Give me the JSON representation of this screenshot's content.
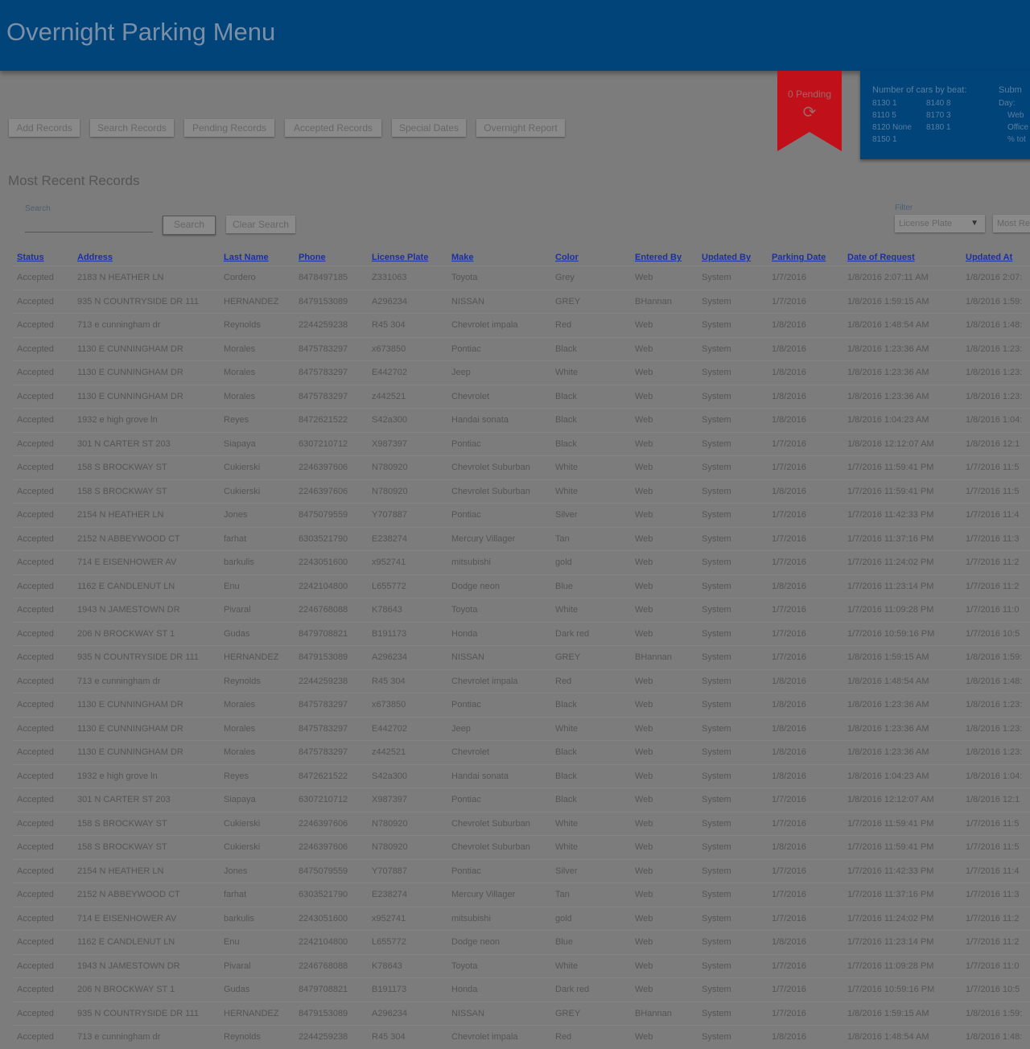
{
  "app": {
    "title": "Overnight Parking Menu"
  },
  "nav": {
    "buttons": [
      "Add Records",
      "Search Records",
      "Pending Records",
      "Accepted Records",
      "Special Dates",
      "Overnight Report"
    ]
  },
  "pending": {
    "label": "0 Pending"
  },
  "stats": {
    "title": "Number of cars by beat:",
    "beats": [
      "8130 1",
      "8140 8",
      "8110 5",
      "8170 3",
      "8120 None",
      "8180 1",
      "8150 1"
    ],
    "submitted": {
      "title": "Subm",
      "day": "Day:",
      "web": "Web",
      "office": "Office",
      "total": "% tot"
    }
  },
  "section": {
    "title": "Most Recent Records"
  },
  "search": {
    "label": "Search",
    "value": "",
    "search_button": "Search",
    "clear_button": "Clear Search"
  },
  "filter": {
    "label": "Filter",
    "selected": "License Plate",
    "sort_selected": "Most Re"
  },
  "table": {
    "columns": [
      "Status",
      "Address",
      "Last Name",
      "Phone",
      "License Plate",
      "Make",
      "Color",
      "Entered By",
      "Updated By",
      "Parking Date",
      "Date of Request",
      "Updated At"
    ],
    "rows": [
      [
        "Accepted",
        "2183 N HEATHER LN",
        "Cordero",
        "8478497185",
        "Z331063",
        "Toyota",
        "Grey",
        "Web",
        "System",
        "1/7/2016",
        "1/8/2016 2:07:11 AM",
        "1/8/2016 2:07:"
      ],
      [
        "Accepted",
        "935 N COUNTRYSIDE DR 111",
        "HERNANDEZ",
        "8479153089",
        "A296234",
        "NISSAN",
        "GREY",
        "BHannan",
        "System",
        "1/7/2016",
        "1/8/2016 1:59:15 AM",
        "1/8/2016 1:59:"
      ],
      [
        "Accepted",
        "713 e cunningham dr",
        "Reynolds",
        "2244259238",
        "R45 304",
        "Chevrolet impala",
        "Red",
        "Web",
        "System",
        "1/8/2016",
        "1/8/2016 1:48:54 AM",
        "1/8/2016 1:48:"
      ],
      [
        "Accepted",
        "1130 E CUNNINGHAM DR",
        "Morales",
        "8475783297",
        "x673850",
        "Pontiac",
        "Black",
        "Web",
        "System",
        "1/8/2016",
        "1/8/2016 1:23:36 AM",
        "1/8/2016 1:23:"
      ],
      [
        "Accepted",
        "1130 E CUNNINGHAM DR",
        "Morales",
        "8475783297",
        "E442702",
        "Jeep",
        "White",
        "Web",
        "System",
        "1/8/2016",
        "1/8/2016 1:23:36 AM",
        "1/8/2016 1:23:"
      ],
      [
        "Accepted",
        "1130 E CUNNINGHAM DR",
        "Morales",
        "8475783297",
        "z442521",
        "Chevrolet",
        "Black",
        "Web",
        "System",
        "1/8/2016",
        "1/8/2016 1:23:36 AM",
        "1/8/2016 1:23:"
      ],
      [
        "Accepted",
        "1932 e high grove ln",
        "Reyes",
        "8472621522",
        "S42a300",
        "Handai sonata",
        "Black",
        "Web",
        "System",
        "1/8/2016",
        "1/8/2016 1:04:23 AM",
        "1/8/2016 1:04:"
      ],
      [
        "Accepted",
        "301 N CARTER ST 203",
        "Siapaya",
        "6307210712",
        "X987397",
        "Pontiac",
        "Black",
        "Web",
        "System",
        "1/7/2016",
        "1/8/2016 12:12:07 AM",
        "1/8/2016 12:1"
      ],
      [
        "Accepted",
        "158 S BROCKWAY ST",
        "Cukierski",
        "2246397606",
        "N780920",
        "Chevrolet Suburban",
        "White",
        "Web",
        "System",
        "1/7/2016",
        "1/7/2016 11:59:41 PM",
        "1/7/2016 11:5"
      ],
      [
        "Accepted",
        "158 S BROCKWAY ST",
        "Cukierski",
        "2246397606",
        "N780920",
        "Chevrolet Suburban",
        "White",
        "Web",
        "System",
        "1/8/2016",
        "1/7/2016 11:59:41 PM",
        "1/7/2016 11:5"
      ],
      [
        "Accepted",
        "2154 N HEATHER LN",
        "Jones",
        "8475079559",
        "Y707887",
        "Pontiac",
        "Silver",
        "Web",
        "System",
        "1/7/2016",
        "1/7/2016 11:42:33 PM",
        "1/7/2016 11:4"
      ],
      [
        "Accepted",
        "2152 N ABBEYWOOD CT",
        "farhat",
        "6303521790",
        "E238274",
        "Mercury Villager",
        "Tan",
        "Web",
        "System",
        "1/7/2016",
        "1/7/2016 11:37:16 PM",
        "1/7/2016 11:3"
      ],
      [
        "Accepted",
        "714 E EISENHOWER AV",
        "barkulis",
        "2243051600",
        "x952741",
        "mitsubishi",
        "gold",
        "Web",
        "System",
        "1/7/2016",
        "1/7/2016 11:24:02 PM",
        "1/7/2016 11:2"
      ],
      [
        "Accepted",
        "1162 E CANDLENUT LN",
        "Enu",
        "2242104800",
        "L655772",
        "Dodge neon",
        "Blue",
        "Web",
        "System",
        "1/8/2016",
        "1/7/2016 11:23:14 PM",
        "1/7/2016 11:2"
      ],
      [
        "Accepted",
        "1943 N JAMESTOWN DR",
        "Pivaral",
        "2246768088",
        "K78643",
        "Toyota",
        "White",
        "Web",
        "System",
        "1/7/2016",
        "1/7/2016 11:09:28 PM",
        "1/7/2016 11:0"
      ],
      [
        "Accepted",
        "206 N BROCKWAY ST 1",
        "Gudas",
        "8479708821",
        "B191173",
        "Honda",
        "Dark red",
        "Web",
        "System",
        "1/7/2016",
        "1/7/2016 10:59:16 PM",
        "1/7/2016 10:5"
      ],
      [
        "Accepted",
        "935 N COUNTRYSIDE DR 111",
        "HERNANDEZ",
        "8479153089",
        "A296234",
        "NISSAN",
        "GREY",
        "BHannan",
        "System",
        "1/7/2016",
        "1/8/2016 1:59:15 AM",
        "1/8/2016 1:59:"
      ],
      [
        "Accepted",
        "713 e cunningham dr",
        "Reynolds",
        "2244259238",
        "R45 304",
        "Chevrolet impala",
        "Red",
        "Web",
        "System",
        "1/8/2016",
        "1/8/2016 1:48:54 AM",
        "1/8/2016 1:48:"
      ],
      [
        "Accepted",
        "1130 E CUNNINGHAM DR",
        "Morales",
        "8475783297",
        "x673850",
        "Pontiac",
        "Black",
        "Web",
        "System",
        "1/8/2016",
        "1/8/2016 1:23:36 AM",
        "1/8/2016 1:23:"
      ],
      [
        "Accepted",
        "1130 E CUNNINGHAM DR",
        "Morales",
        "8475783297",
        "E442702",
        "Jeep",
        "White",
        "Web",
        "System",
        "1/8/2016",
        "1/8/2016 1:23:36 AM",
        "1/8/2016 1:23:"
      ],
      [
        "Accepted",
        "1130 E CUNNINGHAM DR",
        "Morales",
        "8475783297",
        "z442521",
        "Chevrolet",
        "Black",
        "Web",
        "System",
        "1/8/2016",
        "1/8/2016 1:23:36 AM",
        "1/8/2016 1:23:"
      ],
      [
        "Accepted",
        "1932 e high grove ln",
        "Reyes",
        "8472621522",
        "S42a300",
        "Handai sonata",
        "Black",
        "Web",
        "System",
        "1/8/2016",
        "1/8/2016 1:04:23 AM",
        "1/8/2016 1:04:"
      ],
      [
        "Accepted",
        "301 N CARTER ST 203",
        "Siapaya",
        "6307210712",
        "X987397",
        "Pontiac",
        "Black",
        "Web",
        "System",
        "1/7/2016",
        "1/8/2016 12:12:07 AM",
        "1/8/2016 12:1"
      ],
      [
        "Accepted",
        "158 S BROCKWAY ST",
        "Cukierski",
        "2246397606",
        "N780920",
        "Chevrolet Suburban",
        "White",
        "Web",
        "System",
        "1/7/2016",
        "1/7/2016 11:59:41 PM",
        "1/7/2016 11:5"
      ],
      [
        "Accepted",
        "158 S BROCKWAY ST",
        "Cukierski",
        "2246397606",
        "N780920",
        "Chevrolet Suburban",
        "White",
        "Web",
        "System",
        "1/8/2016",
        "1/7/2016 11:59:41 PM",
        "1/7/2016 11:5"
      ],
      [
        "Accepted",
        "2154 N HEATHER LN",
        "Jones",
        "8475079559",
        "Y707887",
        "Pontiac",
        "Silver",
        "Web",
        "System",
        "1/7/2016",
        "1/7/2016 11:42:33 PM",
        "1/7/2016 11:4"
      ],
      [
        "Accepted",
        "2152 N ABBEYWOOD CT",
        "farhat",
        "6303521790",
        "E238274",
        "Mercury Villager",
        "Tan",
        "Web",
        "System",
        "1/7/2016",
        "1/7/2016 11:37:16 PM",
        "1/7/2016 11:3"
      ],
      [
        "Accepted",
        "714 E EISENHOWER AV",
        "barkulis",
        "2243051600",
        "x952741",
        "mitsubishi",
        "gold",
        "Web",
        "System",
        "1/7/2016",
        "1/7/2016 11:24:02 PM",
        "1/7/2016 11:2"
      ],
      [
        "Accepted",
        "1162 E CANDLENUT LN",
        "Enu",
        "2242104800",
        "L655772",
        "Dodge neon",
        "Blue",
        "Web",
        "System",
        "1/8/2016",
        "1/7/2016 11:23:14 PM",
        "1/7/2016 11:2"
      ],
      [
        "Accepted",
        "1943 N JAMESTOWN DR",
        "Pivaral",
        "2246768088",
        "K78643",
        "Toyota",
        "White",
        "Web",
        "System",
        "1/7/2016",
        "1/7/2016 11:09:28 PM",
        "1/7/2016 11:0"
      ],
      [
        "Accepted",
        "206 N BROCKWAY ST 1",
        "Gudas",
        "8479708821",
        "B191173",
        "Honda",
        "Dark red",
        "Web",
        "System",
        "1/7/2016",
        "1/7/2016 10:59:16 PM",
        "1/7/2016 10:5"
      ],
      [
        "Accepted",
        "935 N COUNTRYSIDE DR 111",
        "HERNANDEZ",
        "8479153089",
        "A296234",
        "NISSAN",
        "GREY",
        "BHannan",
        "System",
        "1/7/2016",
        "1/8/2016 1:59:15 AM",
        "1/8/2016 1:59:"
      ],
      [
        "Accepted",
        "713 e cunningham dr",
        "Reynolds",
        "2244259238",
        "R45 304",
        "Chevrolet impala",
        "Red",
        "Web",
        "System",
        "1/8/2016",
        "1/8/2016 1:48:54 AM",
        "1/8/2016 1:48:"
      ]
    ]
  },
  "colors": {
    "header_bg": "#00447a",
    "overlay_bg": "#7c7c7c",
    "ribbon": "#c0111b",
    "link": "#1e2f9e"
  }
}
